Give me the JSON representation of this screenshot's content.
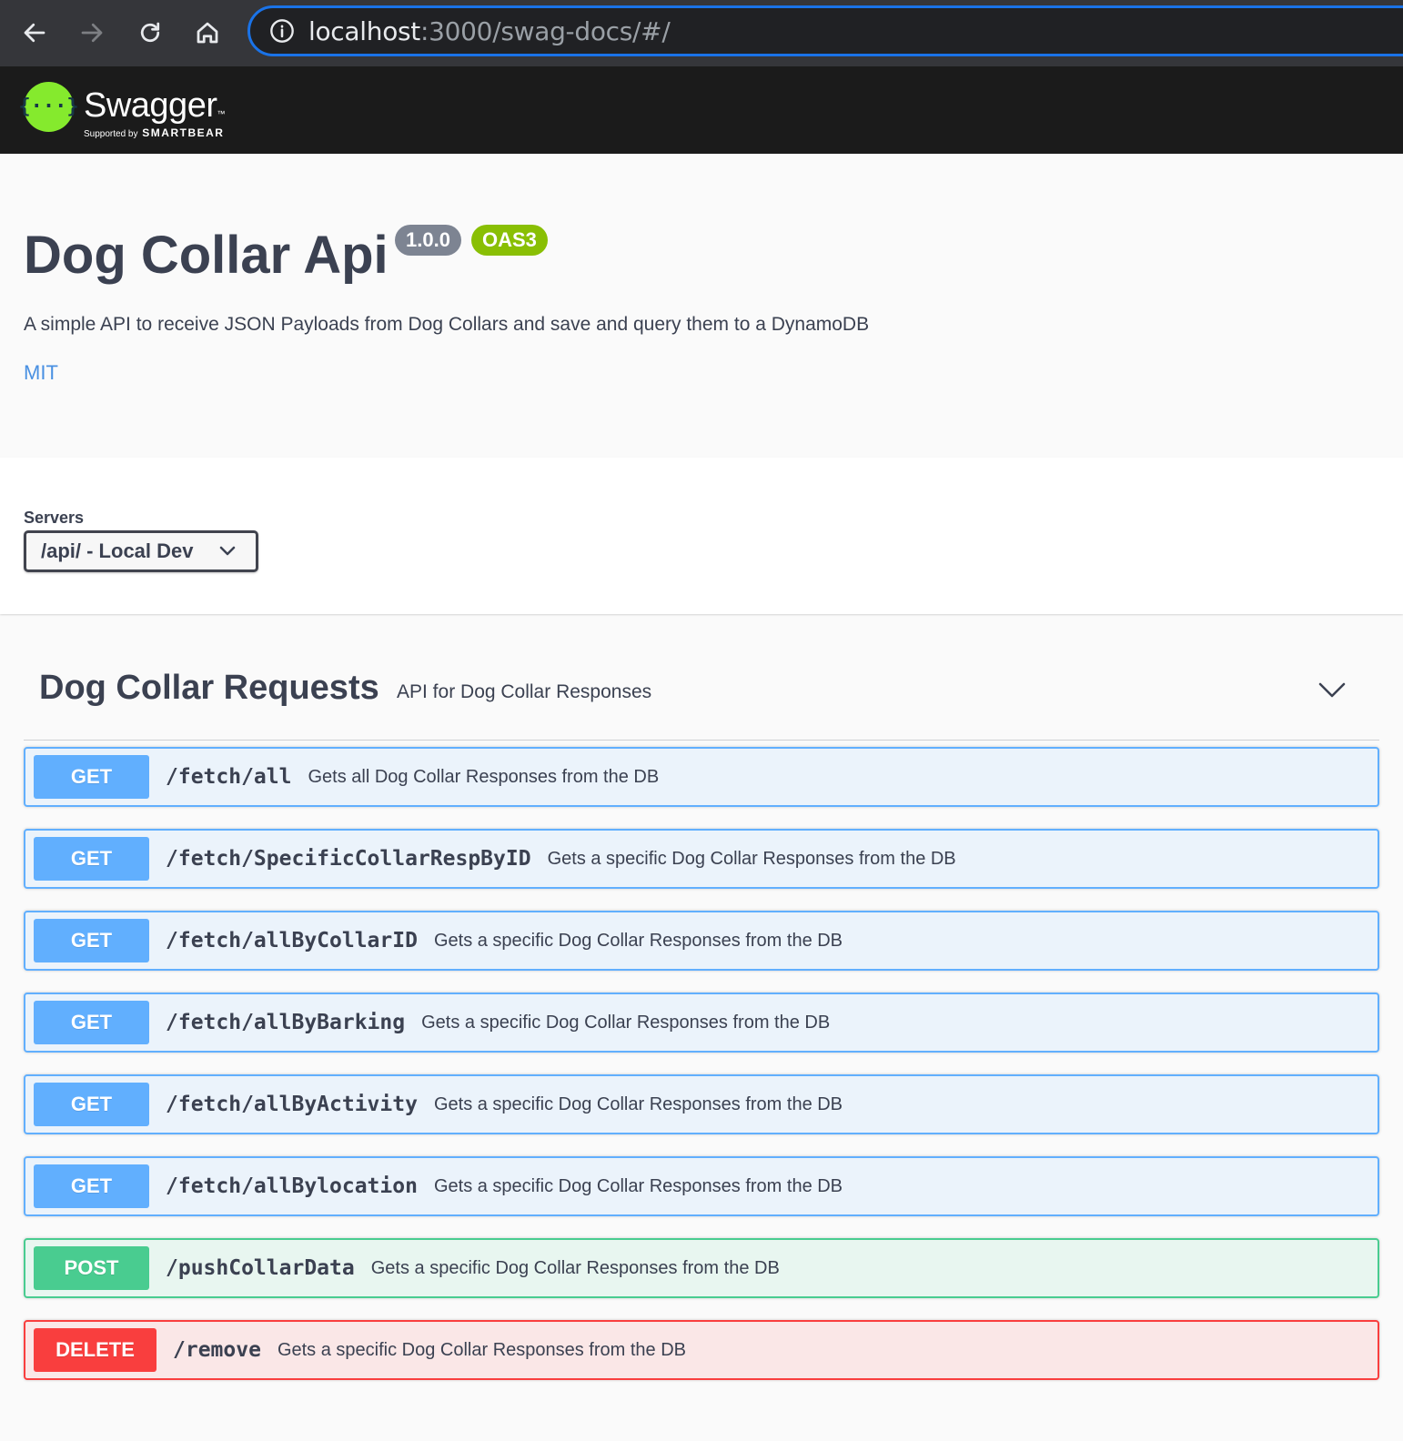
{
  "browser": {
    "url_host": "localhost",
    "url_rest": ":3000/swag-docs/#/",
    "icons": [
      "back-icon",
      "forward-icon",
      "reload-icon",
      "home-icon",
      "info-icon"
    ]
  },
  "topbar": {
    "logo_word": "Swagger",
    "logo_tm": "™",
    "logo_supported": "Supported by",
    "logo_smartbear": "SMARTBEAR",
    "logo_mark": "{···}"
  },
  "info": {
    "title": "Dog Collar Api",
    "version": "1.0.0",
    "oas": "OAS3",
    "description": "A simple API to receive JSON Payloads from Dog Collars and save and query them to a DynamoDB",
    "license": "MIT"
  },
  "servers": {
    "label": "Servers",
    "selected": "/api/ - Local Dev"
  },
  "tag": {
    "name": "Dog Collar Requests",
    "description": "API for Dog Collar Responses"
  },
  "operations": [
    {
      "method": "GET",
      "path": "/fetch/all",
      "summary": "Gets all Dog Collar Responses from the DB"
    },
    {
      "method": "GET",
      "path": "/fetch/SpecificCollarRespByID",
      "summary": "Gets a specific Dog Collar Responses from the DB"
    },
    {
      "method": "GET",
      "path": "/fetch/allByCollarID",
      "summary": "Gets a specific Dog Collar Responses from the DB"
    },
    {
      "method": "GET",
      "path": "/fetch/allByBarking",
      "summary": "Gets a specific Dog Collar Responses from the DB"
    },
    {
      "method": "GET",
      "path": "/fetch/allByActivity",
      "summary": "Gets a specific Dog Collar Responses from the DB"
    },
    {
      "method": "GET",
      "path": "/fetch/allBylocation",
      "summary": "Gets a specific Dog Collar Responses from the DB"
    },
    {
      "method": "POST",
      "path": "/pushCollarData",
      "summary": "Gets a specific Dog Collar Responses from the DB"
    },
    {
      "method": "DELETE",
      "path": "/remove",
      "summary": "Gets a specific Dog Collar Responses from the DB"
    }
  ],
  "colors": {
    "get": "#61affe",
    "post": "#49cc90",
    "delete": "#f93e3e",
    "oas_badge": "#89bf04",
    "version_badge": "#7d8492",
    "link": "#4990e2"
  }
}
